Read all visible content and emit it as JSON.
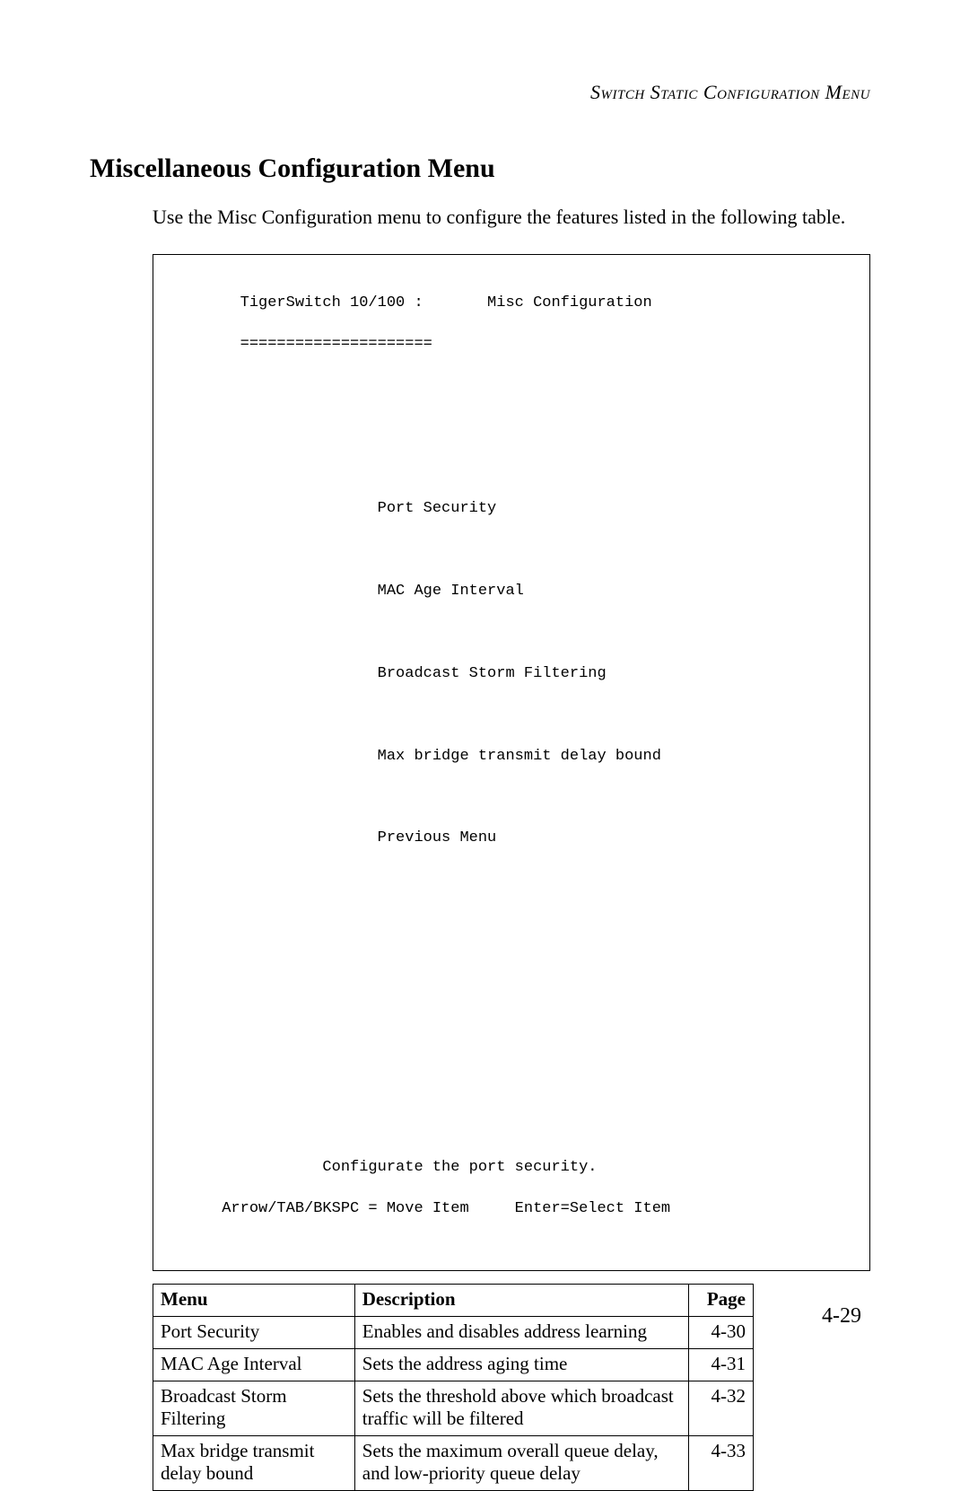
{
  "header": {
    "running_title": "Switch Static Configuration Menu"
  },
  "section": {
    "heading": "Miscellaneous Configuration Menu",
    "intro": "Use the Misc Configuration menu to configure the features listed in the following table."
  },
  "terminal": {
    "title_line": "        TigerSwitch 10/100 :       Misc Configuration",
    "underline": "        =====================",
    "menu_items": [
      "                       Port Security",
      "                       MAC Age Interval",
      "                       Broadcast Storm Filtering",
      "                       Max bridge transmit delay bound",
      "                       Previous Menu"
    ],
    "hint_line": "                 Configurate the port security.",
    "nav_line": "      Arrow/TAB/BKSPC = Move Item     Enter=Select Item"
  },
  "table": {
    "headers": {
      "menu": "Menu",
      "description": "Description",
      "page": "Page"
    },
    "rows": [
      {
        "menu": "Port Security",
        "description": "Enables and disables address learning",
        "page": "4-30"
      },
      {
        "menu": "MAC Age Interval",
        "description": "Sets the address aging time",
        "page": "4-31"
      },
      {
        "menu": "Broadcast Storm Filtering",
        "description": "Sets the threshold above which broadcast traffic will be filtered",
        "page": "4-32"
      },
      {
        "menu": "Max bridge transmit delay bound",
        "description": "Sets the maximum overall queue delay, and low-priority queue delay",
        "page": "4-33"
      }
    ]
  },
  "page_number": "4-29"
}
